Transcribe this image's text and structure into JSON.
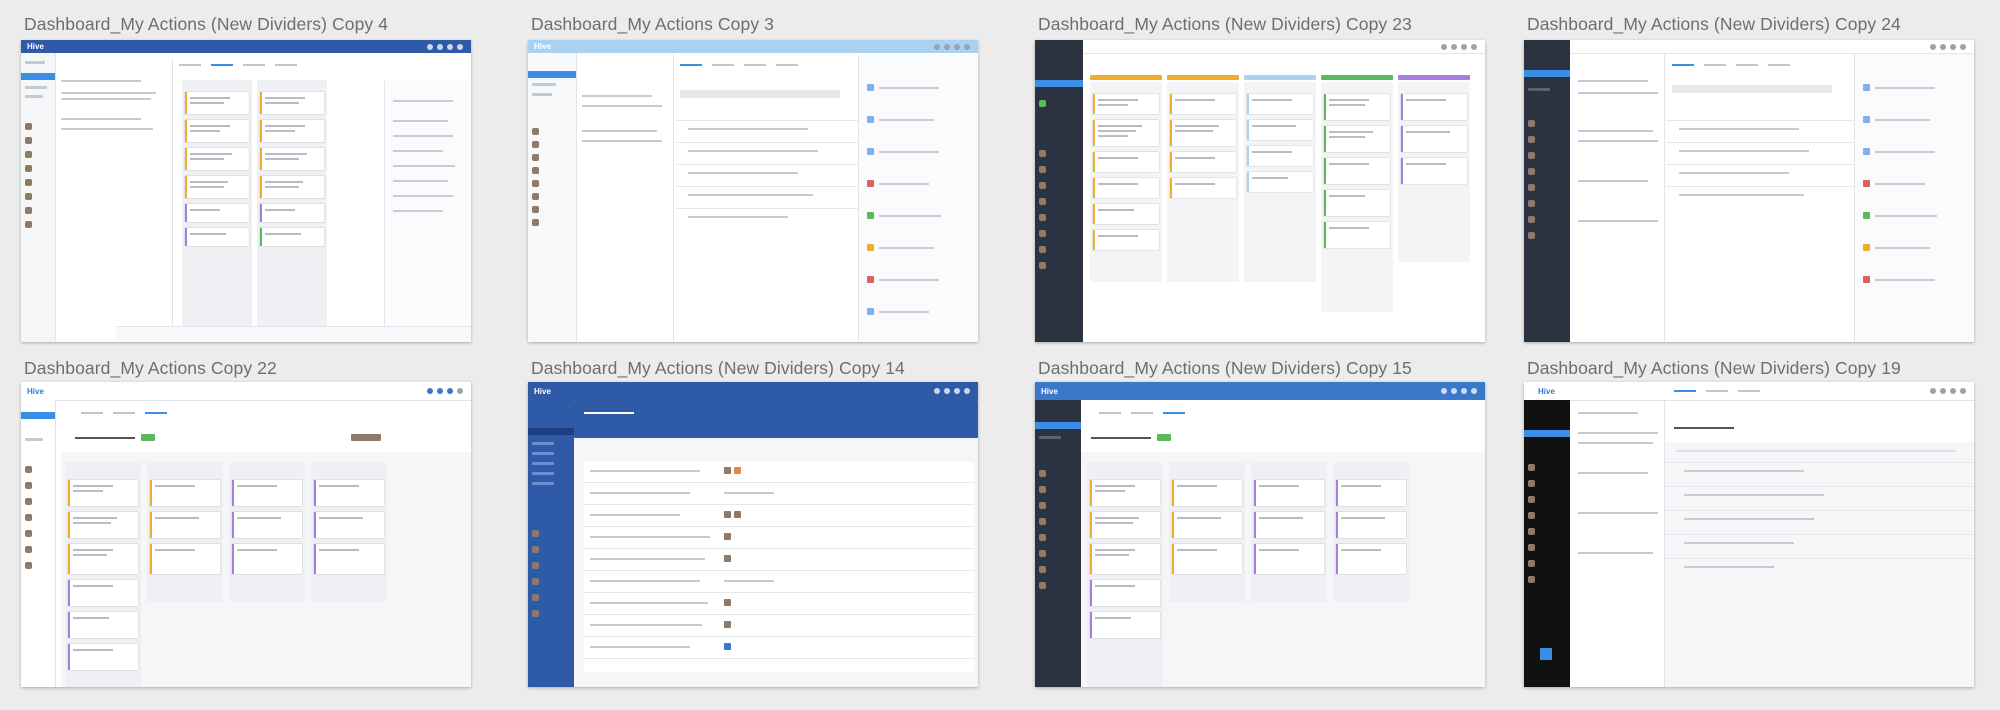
{
  "gallery": {
    "thumbnails": [
      {
        "title": "Dashboard_My Actions (New Dividers) Copy 4"
      },
      {
        "title": "Dashboard_My Actions Copy 3"
      },
      {
        "title": "Dashboard_My Actions (New Dividers) Copy 23"
      },
      {
        "title": "Dashboard_My Actions (New Dividers) Copy 24"
      },
      {
        "title": "Dashboard_My Actions Copy 22"
      },
      {
        "title": "Dashboard_My Actions (New Dividers) Copy 14"
      },
      {
        "title": "Dashboard_My Actions (New Dividers) Copy 15"
      },
      {
        "title": "Dashboard_My Actions (New Dividers) Copy 19"
      }
    ]
  },
  "app": {
    "logo_text": "Hive",
    "colors": {
      "brand_blue": "#2f5aa8",
      "light_blue": "#a9d2f2",
      "dark_nav": "#2b3340",
      "black_nav": "#111111",
      "selected": "#3a8ee6",
      "card_yellow": "#f0ad2b",
      "card_purple": "#a87de0",
      "card_green": "#5cb85c"
    }
  }
}
